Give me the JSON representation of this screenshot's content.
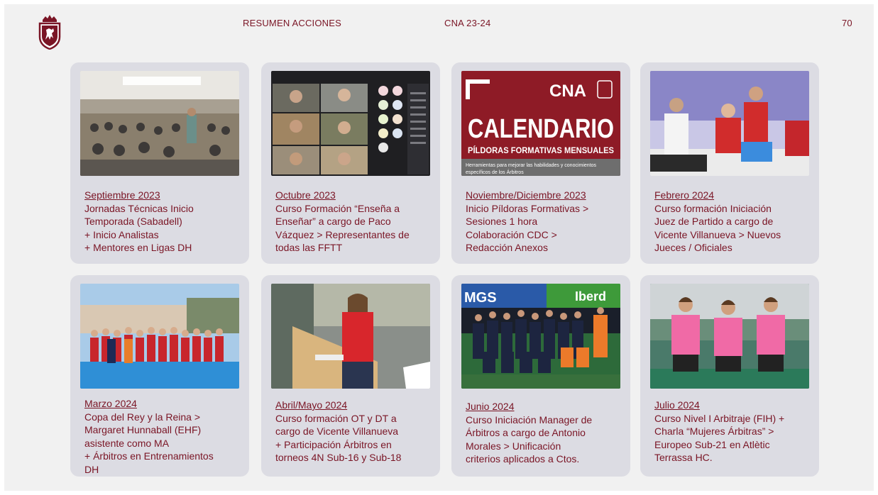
{
  "header": {
    "title": "RESUMEN ACCIONES",
    "subtitle": "CNA 23-24",
    "page_number": "70"
  },
  "colors": {
    "accent": "#7a1525",
    "card_bg": "#dcdce3",
    "slide_bg": "#f1f1f1"
  },
  "cards": [
    {
      "date": "Septiembre 2023",
      "lines": [
        "Jornadas Técnicas Inicio",
        "Temporada (Sabadell)",
        "+ Inicio Analistas",
        "+ Mentores en Ligas DH"
      ]
    },
    {
      "date": "Octubre 2023",
      "lines": [
        "Curso Formación “Enseña a",
        "Enseñar” a cargo de Paco",
        "Vázquez > Representantes de",
        "todas las FFTT"
      ]
    },
    {
      "date": "Noviembre/Diciembre 2023",
      "lines": [
        "Inicio Píldoras Formativas >",
        "Sesiones 1 hora",
        "Colaboración CDC >",
        "Redacción Anexos"
      ],
      "image_text": {
        "brand": "CNA",
        "title": "CALENDARIO",
        "subtitle": "PÍLDORAS FORMATIVAS MENSUALES",
        "caption1": "Herramientas para mejorar las habilidades y conocimientos",
        "caption2": "específicos de los Árbitros"
      }
    },
    {
      "date": "Febrero 2024",
      "lines": [
        "Curso formación Iniciación",
        "Juez de Partido a cargo de",
        "Vicente Villanueva > Nuevos",
        "Jueces / Oficiales"
      ]
    },
    {
      "date": "Marzo 2024",
      "lines": [
        "Copa del Rey y la Reina >",
        "Margaret Hunnaball (EHF)",
        "asistente como MA",
        "+ Árbitros en Entrenamientos",
        "DH"
      ]
    },
    {
      "date": "Abril/Mayo 2024",
      "lines": [
        "Curso formación OT y DT a",
        "cargo de Vicente Villanueva",
        "+ Participación Árbitros en",
        "torneos 4N Sub-16 y Sub-18"
      ]
    },
    {
      "date": "Junio 2024",
      "lines": [
        "Curso Iniciación Manager de",
        "Árbitros a cargo de Antonio",
        "Morales > Unificación",
        "criterios aplicados a Ctos."
      ],
      "image_text": {
        "banner1": "MGS",
        "banner2": "Iberd"
      }
    },
    {
      "date": "Julio 2024",
      "lines": [
        "Curso Nivel I Arbitraje (FIH) +",
        "Charla “Mujeres Árbitras” >",
        "Europeo Sub-21 en Atlètic",
        "Terrassa HC."
      ]
    }
  ]
}
